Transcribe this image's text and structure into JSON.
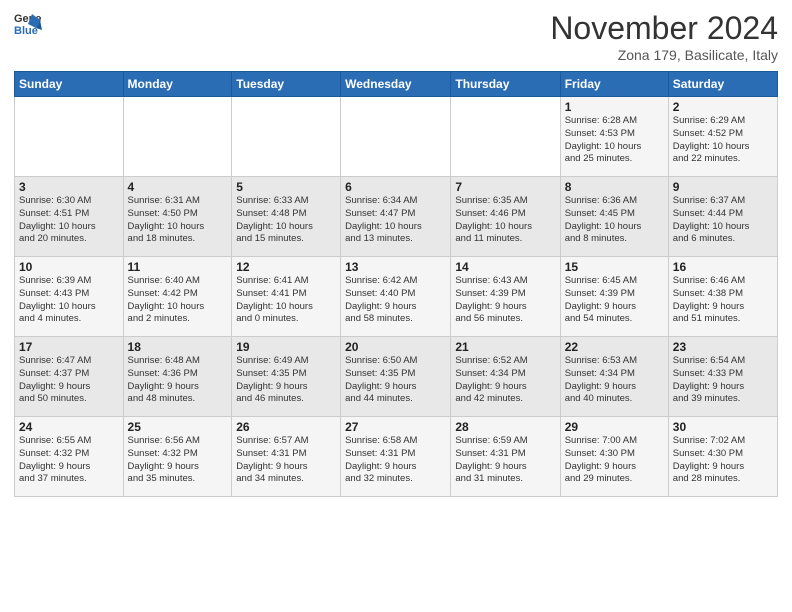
{
  "header": {
    "logo_general": "General",
    "logo_blue": "Blue",
    "month_title": "November 2024",
    "subtitle": "Zona 179, Basilicate, Italy"
  },
  "days_of_week": [
    "Sunday",
    "Monday",
    "Tuesday",
    "Wednesday",
    "Thursday",
    "Friday",
    "Saturday"
  ],
  "weeks": [
    [
      {
        "num": "",
        "info": ""
      },
      {
        "num": "",
        "info": ""
      },
      {
        "num": "",
        "info": ""
      },
      {
        "num": "",
        "info": ""
      },
      {
        "num": "",
        "info": ""
      },
      {
        "num": "1",
        "info": "Sunrise: 6:28 AM\nSunset: 4:53 PM\nDaylight: 10 hours\nand 25 minutes."
      },
      {
        "num": "2",
        "info": "Sunrise: 6:29 AM\nSunset: 4:52 PM\nDaylight: 10 hours\nand 22 minutes."
      }
    ],
    [
      {
        "num": "3",
        "info": "Sunrise: 6:30 AM\nSunset: 4:51 PM\nDaylight: 10 hours\nand 20 minutes."
      },
      {
        "num": "4",
        "info": "Sunrise: 6:31 AM\nSunset: 4:50 PM\nDaylight: 10 hours\nand 18 minutes."
      },
      {
        "num": "5",
        "info": "Sunrise: 6:33 AM\nSunset: 4:48 PM\nDaylight: 10 hours\nand 15 minutes."
      },
      {
        "num": "6",
        "info": "Sunrise: 6:34 AM\nSunset: 4:47 PM\nDaylight: 10 hours\nand 13 minutes."
      },
      {
        "num": "7",
        "info": "Sunrise: 6:35 AM\nSunset: 4:46 PM\nDaylight: 10 hours\nand 11 minutes."
      },
      {
        "num": "8",
        "info": "Sunrise: 6:36 AM\nSunset: 4:45 PM\nDaylight: 10 hours\nand 8 minutes."
      },
      {
        "num": "9",
        "info": "Sunrise: 6:37 AM\nSunset: 4:44 PM\nDaylight: 10 hours\nand 6 minutes."
      }
    ],
    [
      {
        "num": "10",
        "info": "Sunrise: 6:39 AM\nSunset: 4:43 PM\nDaylight: 10 hours\nand 4 minutes."
      },
      {
        "num": "11",
        "info": "Sunrise: 6:40 AM\nSunset: 4:42 PM\nDaylight: 10 hours\nand 2 minutes."
      },
      {
        "num": "12",
        "info": "Sunrise: 6:41 AM\nSunset: 4:41 PM\nDaylight: 10 hours\nand 0 minutes."
      },
      {
        "num": "13",
        "info": "Sunrise: 6:42 AM\nSunset: 4:40 PM\nDaylight: 9 hours\nand 58 minutes."
      },
      {
        "num": "14",
        "info": "Sunrise: 6:43 AM\nSunset: 4:39 PM\nDaylight: 9 hours\nand 56 minutes."
      },
      {
        "num": "15",
        "info": "Sunrise: 6:45 AM\nSunset: 4:39 PM\nDaylight: 9 hours\nand 54 minutes."
      },
      {
        "num": "16",
        "info": "Sunrise: 6:46 AM\nSunset: 4:38 PM\nDaylight: 9 hours\nand 51 minutes."
      }
    ],
    [
      {
        "num": "17",
        "info": "Sunrise: 6:47 AM\nSunset: 4:37 PM\nDaylight: 9 hours\nand 50 minutes."
      },
      {
        "num": "18",
        "info": "Sunrise: 6:48 AM\nSunset: 4:36 PM\nDaylight: 9 hours\nand 48 minutes."
      },
      {
        "num": "19",
        "info": "Sunrise: 6:49 AM\nSunset: 4:35 PM\nDaylight: 9 hours\nand 46 minutes."
      },
      {
        "num": "20",
        "info": "Sunrise: 6:50 AM\nSunset: 4:35 PM\nDaylight: 9 hours\nand 44 minutes."
      },
      {
        "num": "21",
        "info": "Sunrise: 6:52 AM\nSunset: 4:34 PM\nDaylight: 9 hours\nand 42 minutes."
      },
      {
        "num": "22",
        "info": "Sunrise: 6:53 AM\nSunset: 4:34 PM\nDaylight: 9 hours\nand 40 minutes."
      },
      {
        "num": "23",
        "info": "Sunrise: 6:54 AM\nSunset: 4:33 PM\nDaylight: 9 hours\nand 39 minutes."
      }
    ],
    [
      {
        "num": "24",
        "info": "Sunrise: 6:55 AM\nSunset: 4:32 PM\nDaylight: 9 hours\nand 37 minutes."
      },
      {
        "num": "25",
        "info": "Sunrise: 6:56 AM\nSunset: 4:32 PM\nDaylight: 9 hours\nand 35 minutes."
      },
      {
        "num": "26",
        "info": "Sunrise: 6:57 AM\nSunset: 4:31 PM\nDaylight: 9 hours\nand 34 minutes."
      },
      {
        "num": "27",
        "info": "Sunrise: 6:58 AM\nSunset: 4:31 PM\nDaylight: 9 hours\nand 32 minutes."
      },
      {
        "num": "28",
        "info": "Sunrise: 6:59 AM\nSunset: 4:31 PM\nDaylight: 9 hours\nand 31 minutes."
      },
      {
        "num": "29",
        "info": "Sunrise: 7:00 AM\nSunset: 4:30 PM\nDaylight: 9 hours\nand 29 minutes."
      },
      {
        "num": "30",
        "info": "Sunrise: 7:02 AM\nSunset: 4:30 PM\nDaylight: 9 hours\nand 28 minutes."
      }
    ]
  ]
}
